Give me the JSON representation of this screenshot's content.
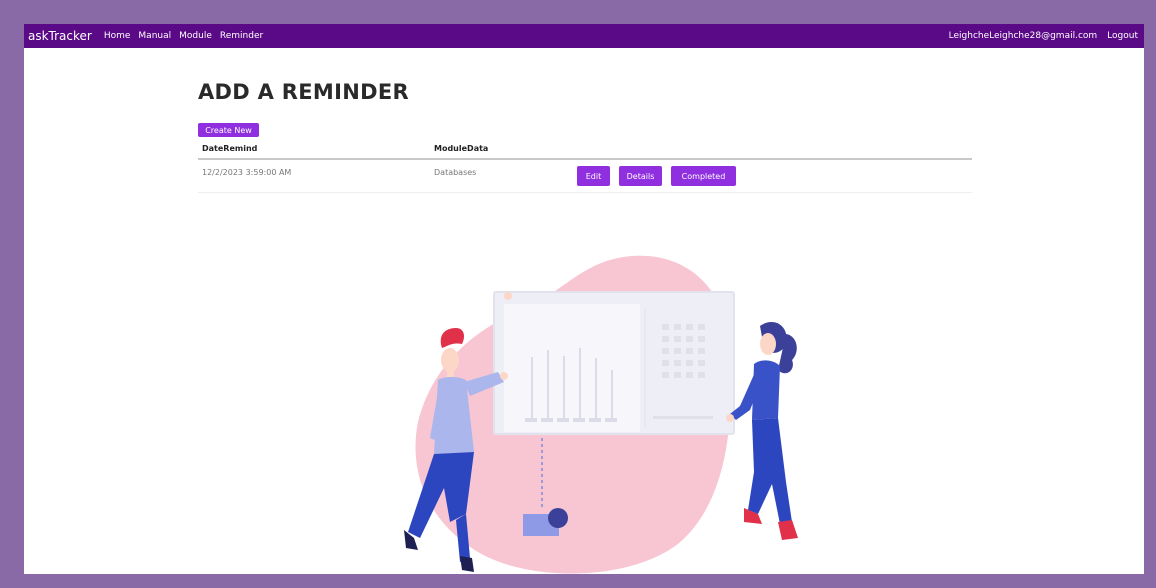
{
  "nav": {
    "brand": "askTracker",
    "links": [
      "Home",
      "Manual",
      "Module",
      "Reminder"
    ],
    "user": "LeighcheLeighche28@gmail.com",
    "logout": "Logout"
  },
  "page": {
    "title": "ADD A REMINDER",
    "create_label": "Create New"
  },
  "table": {
    "headers": [
      "DateRemind",
      "ModuleData"
    ],
    "rows": [
      {
        "date": "12/2/2023 3:59:00 AM",
        "module": "Databases",
        "actions": [
          "Edit",
          "Details",
          "Completed"
        ]
      }
    ]
  },
  "colors": {
    "navbar": "#5a0a86",
    "button": "#8f2fe0",
    "blob": "#f8c6d2",
    "border": "#8a6aa6"
  }
}
